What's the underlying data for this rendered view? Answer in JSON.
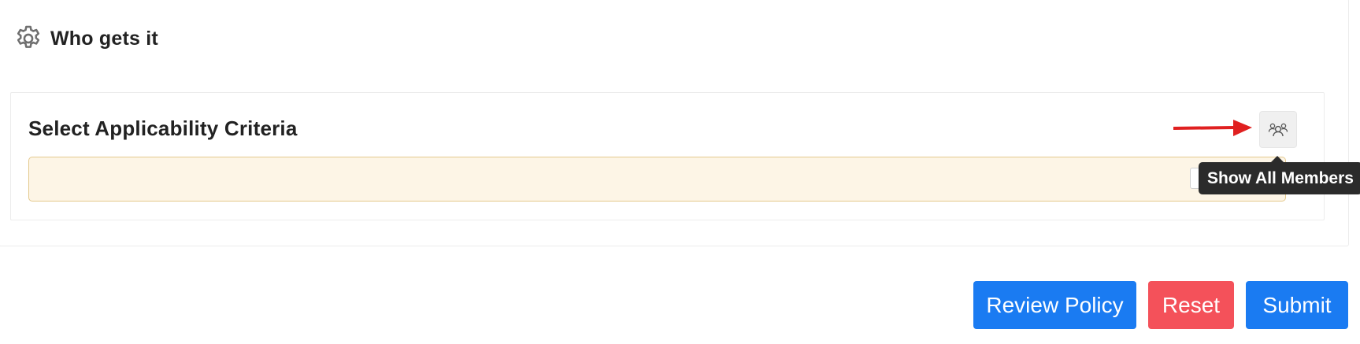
{
  "section": {
    "title": "Who gets it",
    "icon": "gear-icon"
  },
  "criteria": {
    "title": "Select Applicability Criteria",
    "add_button_label": "+",
    "members_icon": "users-icon",
    "tooltip": "Show All Members"
  },
  "actions": {
    "review_label": "Review Policy",
    "reset_label": "Reset",
    "submit_label": "Submit"
  },
  "colors": {
    "primary": "#1a7bf2",
    "danger": "#f4515a",
    "criteria_bg": "#fdf5e6",
    "criteria_border": "#e4c98d",
    "arrow": "#e02020",
    "tooltip_bg": "#2b2b2b"
  }
}
